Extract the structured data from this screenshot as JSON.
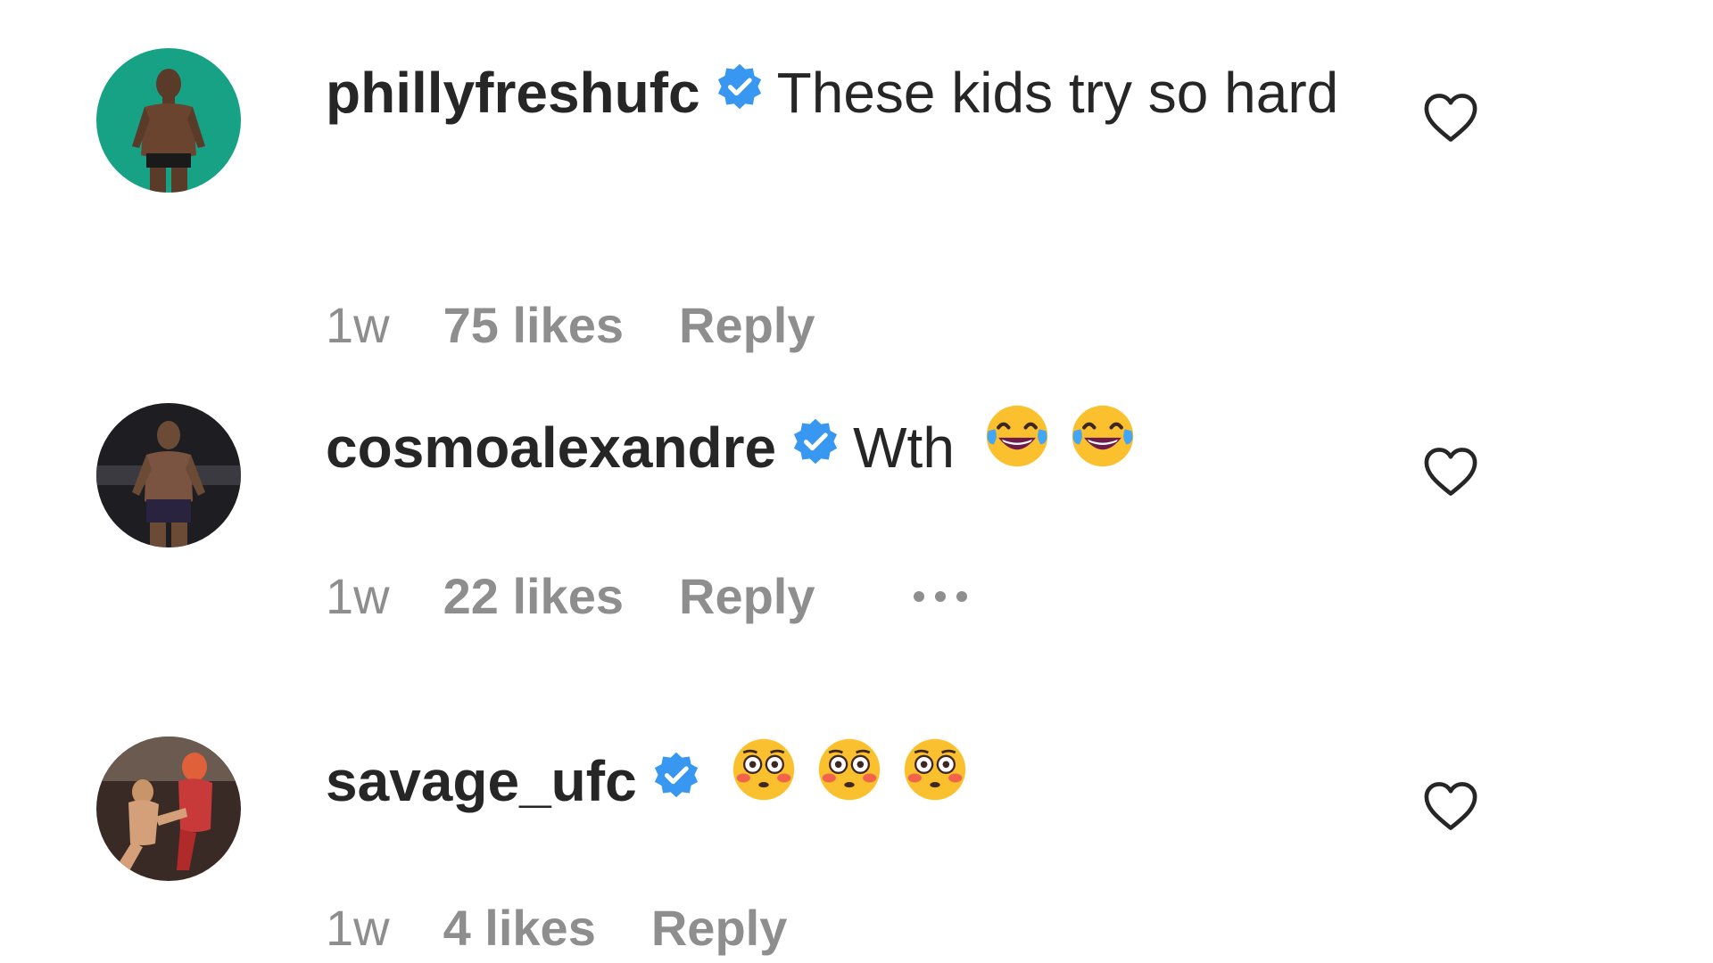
{
  "comments": [
    {
      "username": "phillyfreshufc",
      "verified": true,
      "text": "These kids try so hard",
      "emojis": [],
      "time": "1w",
      "likes": "75 likes",
      "reply": "Reply",
      "avatar_color": "#17a185",
      "liked": false
    },
    {
      "username": "cosmoalexandre",
      "verified": true,
      "text": "Wth",
      "emojis": [
        "face-with-tears-of-joy-icon",
        "face-with-tears-of-joy-icon"
      ],
      "time": "1w",
      "likes": "22 likes",
      "reply": "Reply",
      "avatar_color": "#1e1e22",
      "liked": false
    },
    {
      "username": "savage_ufc",
      "verified": true,
      "text": "",
      "emojis": [
        "flushed-face-icon",
        "flushed-face-icon",
        "flushed-face-icon"
      ],
      "time": "1w",
      "likes": "4 likes",
      "reply": "Reply",
      "avatar_color": "#5a3a32",
      "liked": false
    }
  ],
  "colors": {
    "text": "#262626",
    "secondary": "#8e8e8e",
    "verified_badge": "#3897f0"
  }
}
